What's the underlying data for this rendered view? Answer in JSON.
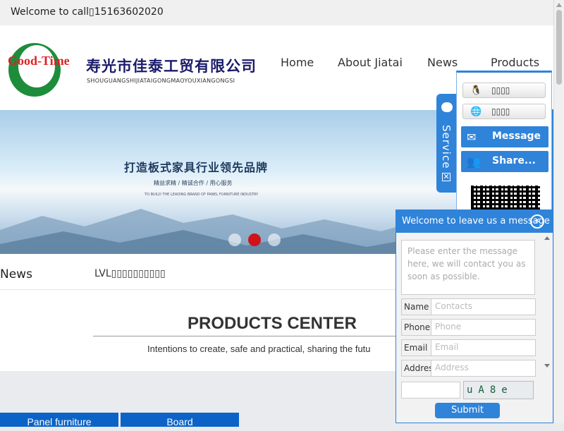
{
  "topbar": {
    "welcome": "Welcome to call\u0000\u0000\u0000\u0000\u0000\u0000\u0000\u0000\u0000\u0000\u0000\u0000\u0000\u0000\u0000\u0000\u0000\u0000\u0000\u0000\u0000\u0000\u0000\u0000\u0000\u0000\u0000\u0000\u0000\u0000\u0000\u0000\u0000\u0000\u0000\u0000\u0000\u0000\u0000\u0000\u0000\u0000\u0000\u0000\u0000\u0000\u0000\u0000\u0000\u0000\u0000\u0000\u0000\u0000\u0000\u0000\u0000\u0000\u0000\u0000\u0000\u0000\u0000\u0000\u0000\u0000\u0000\u0000\u0000\u0000\u0000\u0000\u0000\u0000\u0000\u0000\u0000\u0000\u0000\u0000\u0000\u0000\u0000\u0000\u0000\u0000\u0000\u0000\u0000\u0000\u0000\u0000\u0000\u0000\u0000\u0000\u0000\u0000\u0000\u0000\u0000\u0000\u0000\u0000\u0000\u0000\u0000\u0000\u0000\u0000\u0000\u0000\u0000\u0000\u0000\u0000\u0000\u0000\u0000\u0000\u0000\u0000\u0000\u0000\u0000\u0000\u0000\u0000\u0000\u0000"
  },
  "logo": {
    "brand": "Good-Time",
    "cn_name": "寿光市佳泰工贸有限公司",
    "en_name": "SHOUGUANGSHIJIATAIGONGMAOYOUXIANGONGSI"
  },
  "nav": {
    "items": [
      "Home",
      "About Jiatai",
      "News",
      "Products"
    ]
  },
  "banner": {
    "title": "打造板式家具行业领先品牌",
    "subtitle": "精益求精 / 精诚合作 / 用心服务",
    "subtitle_en": "TO BUILD THE LEADING BRAND OF PANEL FURNITURE INDUSTRY",
    "slide_active": 2,
    "slides": 3
  },
  "news": {
    "label": "News",
    "headline": "LVL\u0000\u0000\u0000\u0000\u0000\u0000\u0000\u0000\u0000\u0000"
  },
  "products": {
    "title": "PRODUCTS CENTER",
    "subtitle": "Intentions to create, safe and practical, sharing the futu",
    "categories": [
      "Panel furniture",
      "Board"
    ]
  },
  "service": {
    "tab_label": "Service",
    "qq1": "\u0000\u0000\u0000\u0000",
    "qq2": "\u0000\u0000\u0000\u0000",
    "message_btn": "Message",
    "share_btn": "Share..."
  },
  "message_box": {
    "title": "Welcome to leave us a message",
    "placeholder": "Please enter the message here, we will contact you as soon as possible.",
    "fields": [
      {
        "label": "Name",
        "placeholder": "Contacts"
      },
      {
        "label": "Phone",
        "placeholder": "Phone"
      },
      {
        "label": "Email",
        "placeholder": "Email"
      },
      {
        "label": "Addres",
        "placeholder": "Address"
      }
    ],
    "captcha": "uA8e",
    "submit": "Submit"
  },
  "colors": {
    "accent": "#2f83d9",
    "category_btn": "#0c63c7",
    "dot_active": "#d0121b"
  }
}
